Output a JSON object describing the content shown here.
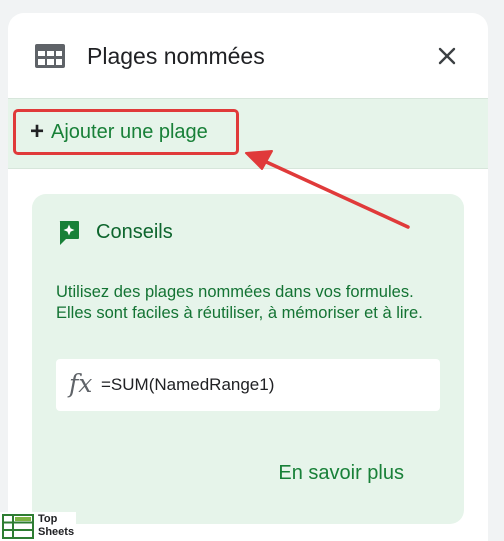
{
  "panel": {
    "title": "Plages nommées",
    "icons": {
      "header": "table-grid-icon",
      "close": "close-icon"
    }
  },
  "add_range": {
    "plus_symbol": "+",
    "label": "Ajouter une plage",
    "icon": "plus-icon"
  },
  "tips": {
    "icon": "sparkle-tip-icon",
    "title": "Conseils",
    "text": "Utilisez des plages nommées dans vos formules. Elles sont faciles à réutiliser, à mémoriser et à lire.",
    "formula_symbol": "fx",
    "formula": "=SUM(NamedRange1)",
    "learn_more": "En savoir plus"
  },
  "watermark": {
    "line1": "Top",
    "line2": "Sheets"
  },
  "colors": {
    "accent_green": "#188038",
    "tip_background": "#e6f4ea",
    "annotation_red": "#e03a3a"
  }
}
